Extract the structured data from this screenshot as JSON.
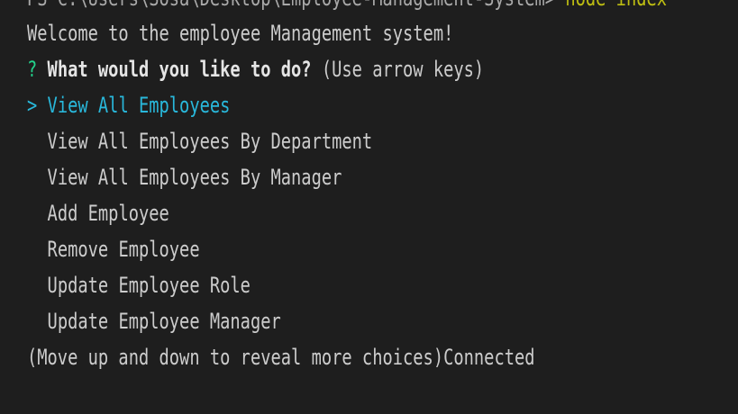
{
  "terminal": {
    "top_line_prefix": "PS C:\\Users\\Sosa\\Desktop\\Employee-Management-System> ",
    "top_line_command": "node index",
    "welcome": "Welcome to the employee Management system!",
    "prompt": {
      "marker": "?",
      "question": "What would you like to do?",
      "hint": "(Use arrow keys)"
    },
    "pointer": ">",
    "choices": [
      "View All Employees",
      "View All Employees By Department",
      "View All Employees By Manager",
      "Add Employee",
      "Remove Employee",
      "Update Employee Role",
      "Update Employee Manager"
    ],
    "footer": "(Move up and down to reveal more choices)Connected"
  },
  "colors": {
    "background": "#1e1e1e",
    "text": "#cccccc",
    "selected": "#29b8db",
    "prompt_marker": "#23d18b",
    "command": "#e5e510"
  }
}
